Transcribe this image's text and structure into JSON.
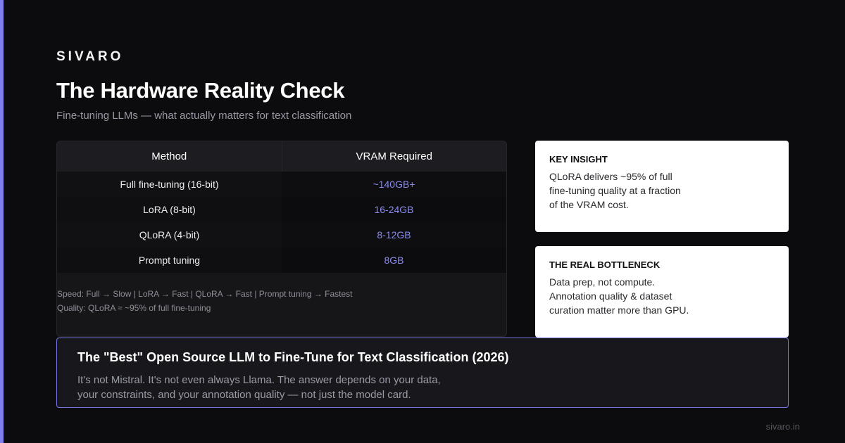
{
  "colors": {
    "accent": "#7f7fef",
    "background": "#0c0c0e",
    "vram_text": "#8a8cf0"
  },
  "brand": "SIVARO",
  "title": "The Hardware Reality Check",
  "subtitle": "Fine-tuning LLMs — what actually matters for text classification",
  "table": {
    "headers": [
      "Method",
      "VRAM Required"
    ],
    "rows": [
      {
        "method": "Full fine-tuning (16-bit)",
        "vram": "~140GB+"
      },
      {
        "method": "LoRA (8-bit)",
        "vram": "16-24GB"
      },
      {
        "method": "QLoRA (4-bit)",
        "vram": "8-12GB"
      },
      {
        "method": "Prompt tuning",
        "vram": "8GB"
      }
    ],
    "notes": [
      "Speed: Full → Slow | LoRA → Fast | QLoRA → Fast | Prompt tuning → Fastest",
      "Quality: QLoRA ≈ ~95% of full fine-tuning"
    ]
  },
  "cards": [
    {
      "label": "KEY INSIGHT",
      "lines": [
        "QLoRA delivers ~95% of full",
        "fine-tuning quality at a fraction",
        "of the VRAM cost."
      ]
    },
    {
      "label": "THE REAL BOTTLENECK",
      "lines": [
        "Data prep, not compute.",
        "Annotation quality & dataset",
        "curation matter more than GPU."
      ]
    }
  ],
  "bottom": {
    "title": "The \"Best\" Open Source LLM to Fine-Tune for Text Classification (2026)",
    "lines": [
      "It's not Mistral. It's not even always Llama. The answer depends on your data,",
      "your constraints, and your annotation quality — not just the model card."
    ]
  },
  "footer": "sivaro.in"
}
